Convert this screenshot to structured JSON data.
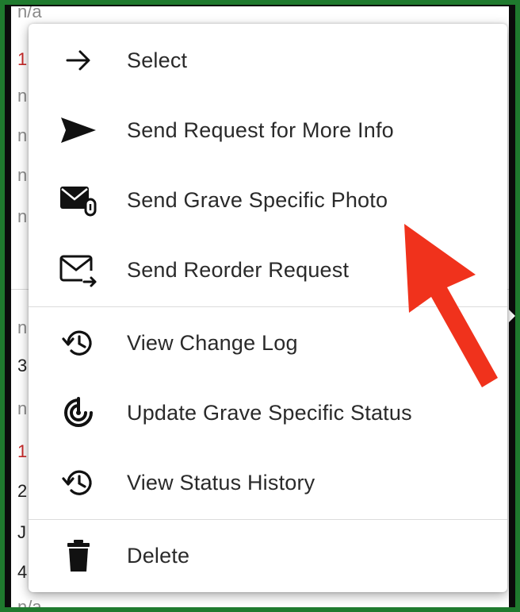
{
  "background_rows": [
    {
      "text": "n/a",
      "tone": "grey"
    },
    {
      "text": "1",
      "tone": "red"
    },
    {
      "text": "n",
      "tone": "grey"
    },
    {
      "text": "n",
      "tone": "grey"
    },
    {
      "text": "n",
      "tone": "grey"
    },
    {
      "text": "n",
      "tone": "grey"
    },
    {
      "text": "n",
      "tone": "grey"
    },
    {
      "text": "3",
      "tone": "dark"
    },
    {
      "text": "n",
      "tone": "grey"
    },
    {
      "text": "1",
      "tone": "red"
    },
    {
      "text": "2",
      "tone": "dark"
    },
    {
      "text": "J",
      "tone": "dark"
    },
    {
      "text": "4",
      "tone": "dark"
    },
    {
      "text": "n/a",
      "tone": "grey"
    }
  ],
  "menu": {
    "items": [
      {
        "id": "select",
        "label": "Select",
        "icon": "arrow-right-icon"
      },
      {
        "id": "send-request-more-info",
        "label": "Send Request for More Info",
        "icon": "send-icon"
      },
      {
        "id": "send-grave-specific-photo",
        "label": "Send Grave Specific Photo",
        "icon": "mail-attachment-icon"
      },
      {
        "id": "send-reorder-request",
        "label": "Send Reorder Request",
        "icon": "mail-forward-icon"
      },
      {
        "id": "view-change-log",
        "label": "View Change Log",
        "icon": "history-icon"
      },
      {
        "id": "update-grave-specific-status",
        "label": "Update Grave Specific Status",
        "icon": "status-target-icon"
      },
      {
        "id": "view-status-history",
        "label": "View Status History",
        "icon": "history-icon"
      },
      {
        "id": "delete",
        "label": "Delete",
        "icon": "trash-icon"
      }
    ]
  },
  "colors": {
    "frame_green": "#1f7a2e",
    "annotation_arrow": "#f0321c",
    "text": "#2a2a2a",
    "accent_red": "#c62828"
  }
}
